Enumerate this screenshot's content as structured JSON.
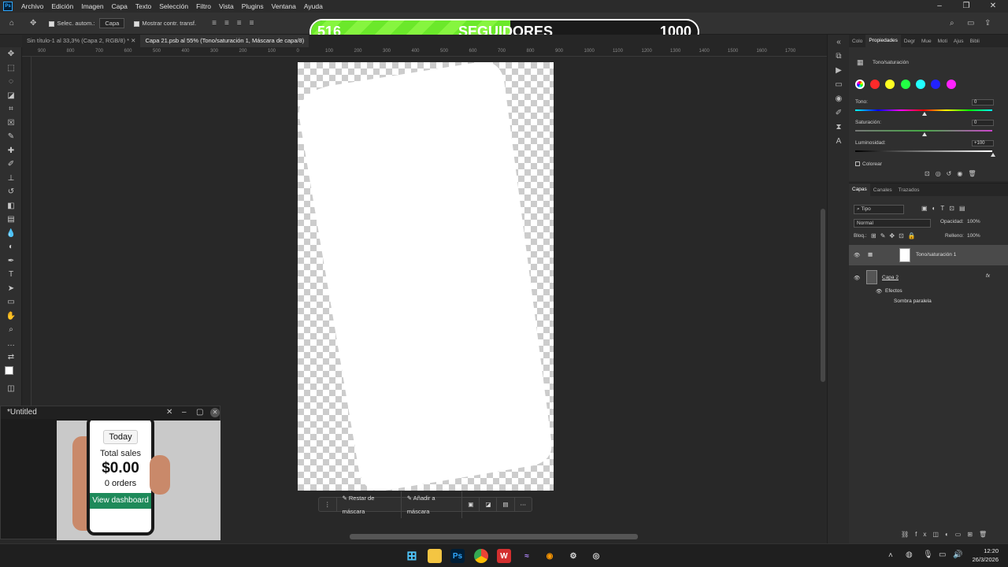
{
  "menubar": {
    "logo": "Ps",
    "items": [
      "Archivo",
      "Edición",
      "Imagen",
      "Capa",
      "Texto",
      "Selección",
      "Filtro",
      "Vista",
      "Plugins",
      "Ventana",
      "Ayuda"
    ]
  },
  "options": {
    "autoselect_label": "Selec. autom.:",
    "autoselect_value": "Capa",
    "transform_label": "Mostrar contr. transf."
  },
  "followers": {
    "current": "516",
    "label": "SEGUIDORES",
    "goal": "1000",
    "progress": 0.516
  },
  "tabs": [
    {
      "label": "Sin título-1 al 33,3% (Capa 2, RGB/8) *"
    },
    {
      "label": "Capa 21.psb al 55% (Tono/saturación 1, Máscara de capa/8)"
    }
  ],
  "ruler": [
    "900",
    "800",
    "700",
    "600",
    "500",
    "400",
    "300",
    "200",
    "100",
    "0",
    "100",
    "200",
    "300",
    "400",
    "500",
    "600",
    "700",
    "800",
    "900",
    "1000",
    "1100",
    "1200",
    "1300",
    "1400",
    "1500",
    "1600",
    "1700"
  ],
  "context_bar": {
    "restar": "Restar de máscara",
    "anadir": "Añadir a máscara"
  },
  "mini_window": {
    "title": "*Untitled",
    "today": "Today",
    "total_sales": "Total sales",
    "amount": "$0.00",
    "orders": "0 orders",
    "dashboard": "View dashboard"
  },
  "properties": {
    "tabs": [
      "Colo",
      "Propiedades",
      "Degr",
      "Mue",
      "Moti",
      "Ajus",
      "Bibli"
    ],
    "title": "Tono/saturación",
    "tono_label": "Tono:",
    "tono_value": "0",
    "sat_label": "Saturación:",
    "sat_value": "0",
    "lum_label": "Luminosidad:",
    "lum_value": "+100",
    "colorear": "Colorear",
    "colors": [
      "#ff2a2a",
      "#ffff22",
      "#22ff44",
      "#22ffff",
      "#2222ff",
      "#ff22ff"
    ]
  },
  "layers": {
    "tabs": [
      "Capas",
      "Canales",
      "Trazados"
    ],
    "filter": "Tipo",
    "blend": "Normal",
    "opacity_label": "Opacidad:",
    "opacity": "100%",
    "lock_label": "Bloq.:",
    "fill_label": "Relleno:",
    "fill": "100%",
    "layer1": "Tono/saturación 1",
    "layer2": "Capa 2",
    "effects": "Efectos",
    "shadow": "Sombra paralela"
  },
  "taskbar": {
    "time": "12:20",
    "date": "26/3/2026"
  }
}
